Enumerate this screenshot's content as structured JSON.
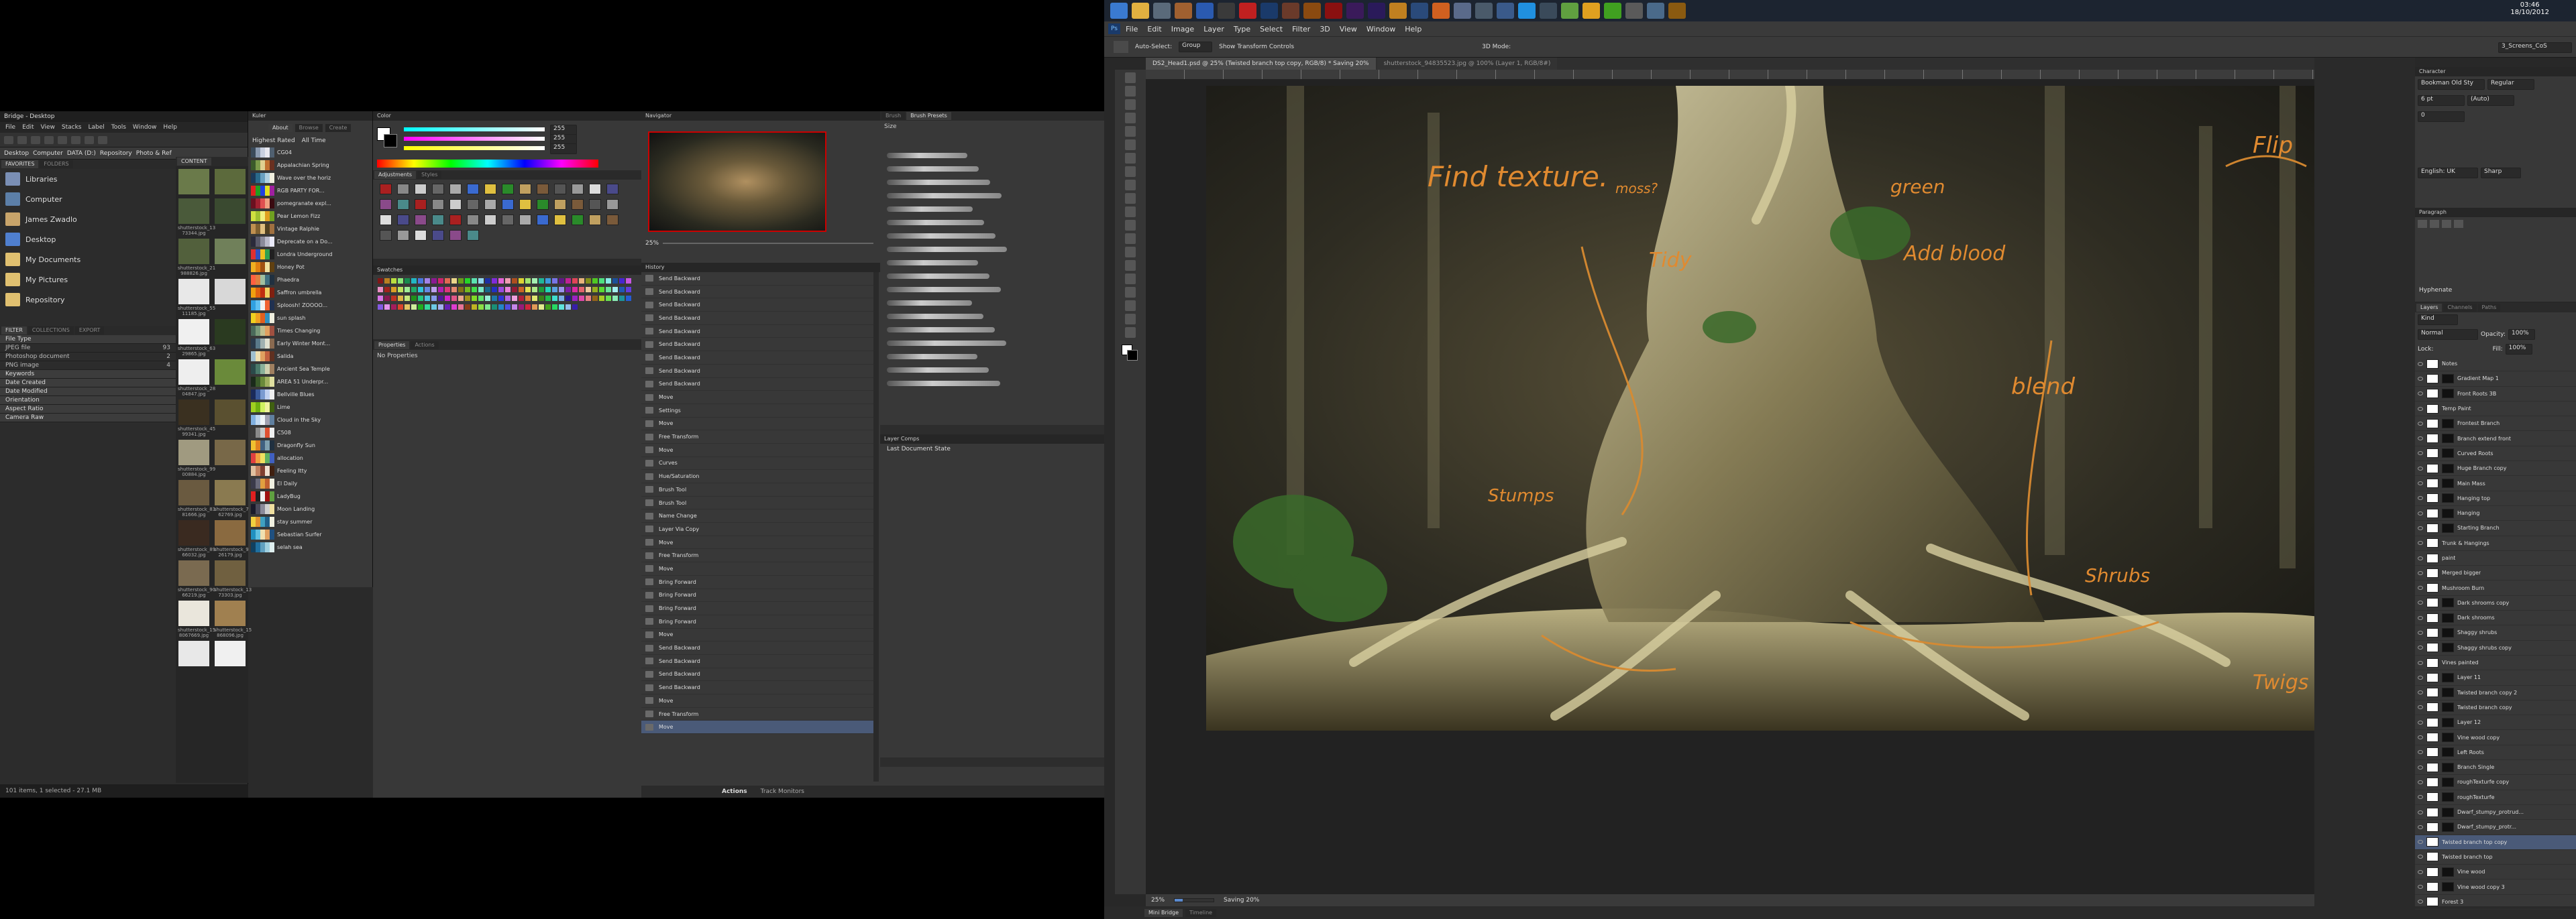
{
  "bridge": {
    "title": "Bridge - Desktop",
    "menu": [
      "File",
      "Edit",
      "View",
      "Stacks",
      "Label",
      "Tools",
      "Window",
      "Help"
    ],
    "breadcrumb": [
      "Desktop",
      "Computer",
      "DATA (D:)",
      "Repository",
      "Photo & Ref"
    ],
    "tabs": [
      "FAVORITES",
      "FOLDERS"
    ],
    "content_tab": "CONTENT",
    "favorites": [
      {
        "label": "Libraries",
        "color": "#7a8fb5"
      },
      {
        "label": "Computer",
        "color": "#5c7fa8"
      },
      {
        "label": "James Zwadlo",
        "color": "#c8a46a"
      },
      {
        "label": "Desktop",
        "color": "#4f7fcf"
      },
      {
        "label": "My Documents",
        "color": "#e0c070"
      },
      {
        "label": "My Pictures",
        "color": "#e0c070"
      },
      {
        "label": "Repository",
        "color": "#e0c070"
      }
    ],
    "filter_tabs": [
      "FILTER",
      "COLLECTIONS",
      "EXPORT"
    ],
    "filters": [
      {
        "label": "File Type",
        "count": "",
        "header": true
      },
      {
        "label": "JPEG file",
        "count": "93",
        "header": false
      },
      {
        "label": "Photoshop document",
        "count": "2",
        "header": false
      },
      {
        "label": "PNG image",
        "count": "4",
        "header": false
      },
      {
        "label": "Keywords",
        "count": "",
        "header": true
      },
      {
        "label": "Date Created",
        "count": "",
        "header": true
      },
      {
        "label": "Date Modified",
        "count": "",
        "header": true
      },
      {
        "label": "Orientation",
        "count": "",
        "header": true
      },
      {
        "label": "Aspect Ratio",
        "count": "",
        "header": true
      },
      {
        "label": "Camera Raw",
        "count": "",
        "header": true
      }
    ],
    "thumbnails": [
      {
        "name": "",
        "color": "#6a7a4a"
      },
      {
        "name": "",
        "color": "#5c6a3c"
      },
      {
        "name": "shutterstock_13 73344.jpg",
        "color": "#4a5a3a"
      },
      {
        "name": "",
        "color": "#3a4a30"
      },
      {
        "name": "shutterstock_21 988826.jpg",
        "color": "#52603c"
      },
      {
        "name": "",
        "color": "#70805a"
      },
      {
        "name": "shutterstock_55 11185.jpg",
        "color": "#e8e8e8"
      },
      {
        "name": "",
        "color": "#d8d8d8"
      },
      {
        "name": "shutterstock_63 29865.jpg",
        "color": "#f0f0f0"
      },
      {
        "name": "",
        "color": "#2a3a20"
      },
      {
        "name": "shutterstock_28 04847.jpg",
        "color": "#eeeeee"
      },
      {
        "name": "",
        "color": "#6a8a3a"
      },
      {
        "name": "shutterstock_45 99341.jpg",
        "color": "#3a3020"
      },
      {
        "name": "",
        "color": "#5a5030"
      },
      {
        "name": "shutterstock_99 00884.jpg",
        "color": "#a09a80"
      },
      {
        "name": "",
        "color": "#786848"
      },
      {
        "name": "shutterstock_83 81666.jpg",
        "color": "#6a5a40"
      },
      {
        "name": "shutterstock_73 62769.jpg",
        "color": "#8a7a50"
      },
      {
        "name": "shutterstock_89 66032.jpg",
        "color": "#3a2a20"
      },
      {
        "name": "shutterstock_96 26179.jpg",
        "color": "#8a6a40"
      },
      {
        "name": "shutterstock_90 66219.jpg",
        "color": "#7a6a50"
      },
      {
        "name": "shutterstock_13 73303.jpg",
        "color": "#706040"
      },
      {
        "name": "shutterstock_15 8067669.jpg",
        "color": "#eae6dc"
      },
      {
        "name": "shutterstock_15 868096.jpg",
        "color": "#a08050"
      },
      {
        "name": "",
        "color": "#e8e8e8"
      },
      {
        "name": "",
        "color": "#f0f0f0"
      }
    ],
    "status": "101 items, 1 selected - 27.1 MB"
  },
  "kuler": {
    "title": "Kuler",
    "tabs": [
      "About",
      "Browse",
      "Create"
    ],
    "sort": [
      "Highest Rated",
      "All Time"
    ],
    "themes": [
      {
        "name": "CG04",
        "colors": [
          "#3a4a5a",
          "#8a9ab0",
          "#c8d0e0",
          "#e8e8f0",
          "#506070"
        ]
      },
      {
        "name": "Appalachian Spring",
        "colors": [
          "#3a5a2a",
          "#7a9a4a",
          "#e0d090",
          "#c07030",
          "#6a3020"
        ]
      },
      {
        "name": "Wave over the horiz",
        "colors": [
          "#1a3a5a",
          "#2a6a8a",
          "#6aa0c0",
          "#b0d0e0",
          "#f0f0e0"
        ]
      },
      {
        "name": "RGB PARTY FOR...",
        "colors": [
          "#e02020",
          "#20a020",
          "#2040e0",
          "#e0e020",
          "#a020a0"
        ]
      },
      {
        "name": "pomegranate expl...",
        "colors": [
          "#6a1020",
          "#a02030",
          "#e05050",
          "#f0a080",
          "#3a0a10"
        ]
      },
      {
        "name": "Pear Lemon Fizz",
        "colors": [
          "#d0e040",
          "#a0c030",
          "#f0f080",
          "#e0a020",
          "#70a020"
        ]
      },
      {
        "name": "Vintage Ralphie",
        "colors": [
          "#c09050",
          "#806030",
          "#e0c080",
          "#504020",
          "#a07040"
        ]
      },
      {
        "name": "Deprecate on a Do...",
        "colors": [
          "#2a2a3a",
          "#5a5a6a",
          "#8a8a9a",
          "#babaca",
          "#eaeafa"
        ]
      },
      {
        "name": "Londra Underground",
        "colors": [
          "#e03030",
          "#3050c0",
          "#f0c020",
          "#30a050",
          "#202020"
        ]
      },
      {
        "name": "Honey Pot",
        "colors": [
          "#f0b020",
          "#e08010",
          "#a05010",
          "#f0e0a0",
          "#604010"
        ]
      },
      {
        "name": "Phaedra",
        "colors": [
          "#ff6040",
          "#e08040",
          "#a0c0a0",
          "#407080",
          "#203040"
        ]
      },
      {
        "name": "Saffron umbrella",
        "colors": [
          "#f0a010",
          "#e06010",
          "#c03010",
          "#f0d060",
          "#802010"
        ]
      },
      {
        "name": "Sploosh! ZOOOO...",
        "colors": [
          "#30a0e0",
          "#60c0f0",
          "#f0f0f0",
          "#f06030",
          "#203050"
        ]
      },
      {
        "name": "sun splash",
        "colors": [
          "#f0d020",
          "#f0a020",
          "#e06020",
          "#3090c0",
          "#f0f0e0"
        ]
      },
      {
        "name": "Times Changing",
        "colors": [
          "#4a6a5a",
          "#7a9a7a",
          "#c0c090",
          "#e0a060",
          "#a05040"
        ]
      },
      {
        "name": "Early Winter Mont...",
        "colors": [
          "#2a3a4a",
          "#5a7a8a",
          "#a0b0b0",
          "#e0e0d0",
          "#8a6a50"
        ]
      },
      {
        "name": "Salida",
        "colors": [
          "#a0c0d0",
          "#f0e0b0",
          "#e0a060",
          "#c06040",
          "#603020"
        ]
      },
      {
        "name": "Ancient Sea Temple",
        "colors": [
          "#2a4a4a",
          "#4a7a6a",
          "#8ab09a",
          "#d0d0b0",
          "#a08060"
        ]
      },
      {
        "name": "AREA 51 Underpr...",
        "colors": [
          "#1a2a1a",
          "#3a5a2a",
          "#6a8a3a",
          "#a0b060",
          "#e0e0a0"
        ]
      },
      {
        "name": "Bellville Blues",
        "colors": [
          "#1a2a5a",
          "#3a5a9a",
          "#7a9ad0",
          "#c0d0f0",
          "#f0f0f0"
        ]
      },
      {
        "name": "Lime",
        "colors": [
          "#a0d020",
          "#70b010",
          "#d0f060",
          "#f0f0a0",
          "#406010"
        ]
      },
      {
        "name": "Cloud in the Sky",
        "colors": [
          "#80b0e0",
          "#c0d8f0",
          "#f0f4f8",
          "#a0a0b0",
          "#6080a0"
        ]
      },
      {
        "name": "C508",
        "colors": [
          "#3a3a3a",
          "#8a8a8a",
          "#c8c8c8",
          "#e05030",
          "#f0f0f0"
        ]
      },
      {
        "name": "Dragonfly Sun",
        "colors": [
          "#f0c030",
          "#e08020",
          "#406080",
          "#80a0b0",
          "#203040"
        ]
      },
      {
        "name": "allocation",
        "colors": [
          "#e04040",
          "#f0a040",
          "#f0e060",
          "#60b060",
          "#4060c0"
        ]
      },
      {
        "name": "Feeling Itty",
        "colors": [
          "#e0c0a0",
          "#c08060",
          "#804030",
          "#f0e0d0",
          "#402010"
        ]
      },
      {
        "name": "El Daily",
        "colors": [
          "#3a3a4a",
          "#6a6a7a",
          "#e0a040",
          "#c06030",
          "#f0f0e0"
        ]
      },
      {
        "name": "LadyBug",
        "colors": [
          "#e02020",
          "#202020",
          "#f0f0f0",
          "#a01010",
          "#60a040"
        ]
      },
      {
        "name": "Moon Landing",
        "colors": [
          "#1a1a2a",
          "#4a4a5a",
          "#8a8a9a",
          "#d0d0d0",
          "#f0e0a0"
        ]
      },
      {
        "name": "stay summer",
        "colors": [
          "#f0d040",
          "#e09030",
          "#40a0c0",
          "#20608a",
          "#f0f0e0"
        ]
      },
      {
        "name": "Sebastian Surfer",
        "colors": [
          "#2090c0",
          "#60c0e0",
          "#f0e0b0",
          "#e0a060",
          "#205080"
        ]
      },
      {
        "name": "selah sea",
        "colors": [
          "#104060",
          "#2070a0",
          "#60a0c0",
          "#a0d0e0",
          "#e0f0f0"
        ]
      }
    ]
  },
  "color_panel": {
    "tabs": [
      "Color"
    ],
    "r": "255",
    "g": "255",
    "b": "255"
  },
  "styles_panel": {
    "tabs": [
      "Adjustments",
      "Styles"
    ]
  },
  "swatches_panel": {
    "tabs": [
      "Swatches"
    ]
  },
  "properties_panel": {
    "tabs": [
      "Properties",
      "Actions"
    ],
    "subtitle": "No Properties"
  },
  "navigator": {
    "title": "Navigator",
    "zoom": "25%"
  },
  "history": {
    "title": "History",
    "items": [
      "Send Backward",
      "Send Backward",
      "Send Backward",
      "Send Backward",
      "Send Backward",
      "Send Backward",
      "Send Backward",
      "Send Backward",
      "Send Backward",
      "Move",
      "Settings",
      "Move",
      "Free Transform",
      "Move",
      "Curves",
      "Hue/Saturation",
      "Brush Tool",
      "Brush Tool",
      "Name Change",
      "Layer Via Copy",
      "Move",
      "Free Transform",
      "Move",
      "Bring Forward",
      "Bring Forward",
      "Bring Forward",
      "Bring Forward",
      "Move",
      "Send Backward",
      "Send Backward",
      "Send Backward",
      "Send Backward",
      "Move",
      "Free Transform",
      "Move"
    ]
  },
  "brush_presets": {
    "tabs": [
      "Brush",
      "Brush Presets"
    ],
    "size_label": "Size"
  },
  "layer_comps": {
    "title": "Layer Comps",
    "item": "Last Document State"
  },
  "actions_bar": {
    "label": "Actions",
    "sub": "Track Monitors"
  },
  "taskbar": {
    "icons": [
      {
        "name": "windows-start-icon",
        "color": "#3a7ad0"
      },
      {
        "name": "explorer-icon",
        "color": "#e0b040"
      },
      {
        "name": "app-icon-1",
        "color": "#5a6a7a"
      },
      {
        "name": "app-icon-2",
        "color": "#a06030"
      },
      {
        "name": "word-icon",
        "color": "#2a5ab0"
      },
      {
        "name": "app-icon-3",
        "color": "#3a3a3a"
      },
      {
        "name": "acrobat-icon",
        "color": "#c02020"
      },
      {
        "name": "photoshop-icon",
        "color": "#1a3a6a"
      },
      {
        "name": "app-icon-4",
        "color": "#6a3a2a"
      },
      {
        "name": "illustrator-icon",
        "color": "#8a4a10"
      },
      {
        "name": "flash-icon",
        "color": "#8a1010"
      },
      {
        "name": "premiere-icon",
        "color": "#3a1a5a"
      },
      {
        "name": "after-effects-icon",
        "color": "#2a1a5a"
      },
      {
        "name": "app-icon-5",
        "color": "#c08020"
      },
      {
        "name": "app-icon-6",
        "color": "#2a4a7a"
      },
      {
        "name": "app-icon-7",
        "color": "#d06020"
      },
      {
        "name": "app-icon-8",
        "color": "#5a6a8a"
      },
      {
        "name": "app-icon-9",
        "color": "#4a5a6a"
      },
      {
        "name": "app-icon-10",
        "color": "#3a5a8a"
      },
      {
        "name": "skype-icon",
        "color": "#2090e0"
      },
      {
        "name": "app-icon-11",
        "color": "#3a4a5a"
      },
      {
        "name": "app-icon-12",
        "color": "#60a040"
      },
      {
        "name": "chrome-icon",
        "color": "#e0a020"
      },
      {
        "name": "spotify-icon",
        "color": "#40a020"
      },
      {
        "name": "app-icon-13",
        "color": "#5a5a5a"
      },
      {
        "name": "app-icon-14",
        "color": "#4a6a8a"
      },
      {
        "name": "bridge-icon",
        "color": "#8a5a10"
      }
    ],
    "clock_time": "03:46",
    "clock_date": "18/10/2012"
  },
  "photoshop": {
    "menu": [
      "File",
      "Edit",
      "Image",
      "Layer",
      "Type",
      "Select",
      "Filter",
      "3D",
      "View",
      "Window",
      "Help"
    ],
    "options": {
      "auto_select": "Auto-Select:",
      "group": "Group",
      "transform": "Show Transform Controls",
      "mode": "3D Mode:",
      "workspace": "3_Screens_CoS"
    },
    "doc_tabs": [
      {
        "label": "DS2_Head1.psd @ 25% (Twisted branch top copy, RGB/8) * Saving 20%",
        "active": true
      },
      {
        "label": "shutterstock_94835523.jpg @ 100% (Layer 1, RGB/8#)",
        "active": false
      }
    ],
    "status_zoom": "25%",
    "status_text": "Saving 20%",
    "bottom_tabs": [
      "Mini Bridge",
      "Timeline"
    ],
    "annotations": [
      "Find texture.",
      "moss?",
      "Tidy",
      "green",
      "Add blood",
      "blend",
      "Flip",
      "Shrubs",
      "Twigs",
      "Stumps"
    ]
  },
  "character_panel": {
    "tabs": [
      "Character"
    ],
    "font": "Bookman Old Sty",
    "style": "Regular",
    "size": "6 pt",
    "leading": "(Auto)",
    "tracking": "0",
    "lang": "English: UK",
    "aa": "Sharp"
  },
  "paragraph_panel": {
    "tabs": [
      "Paragraph"
    ],
    "hyphenate": "Hyphenate"
  },
  "layers_panel": {
    "tabs": [
      "Layers",
      "Channels",
      "Paths"
    ],
    "kind": "Kind",
    "blend": "Normal",
    "opacity_label": "Opacity:",
    "opacity": "100%",
    "lock_label": "Lock:",
    "fill_label": "Fill:",
    "fill": "100%",
    "layers": [
      {
        "name": "Notes",
        "mask": false,
        "sel": false
      },
      {
        "name": "Gradient Map 1",
        "mask": true,
        "sel": false
      },
      {
        "name": "Front Roots 3B",
        "mask": true,
        "sel": false
      },
      {
        "name": "Temp Paint",
        "mask": false,
        "sel": false
      },
      {
        "name": "Frontest Branch",
        "mask": true,
        "sel": false
      },
      {
        "name": "Branch extend front",
        "mask": true,
        "sel": false
      },
      {
        "name": "Curved Roots",
        "mask": true,
        "sel": false
      },
      {
        "name": "Huge Branch copy",
        "mask": true,
        "sel": false
      },
      {
        "name": "Main Mass",
        "mask": true,
        "sel": false
      },
      {
        "name": "Hanging top",
        "mask": true,
        "sel": false
      },
      {
        "name": "Hanging",
        "mask": true,
        "sel": false
      },
      {
        "name": "Starting Branch",
        "mask": true,
        "sel": false
      },
      {
        "name": "Trunk & Hangings",
        "mask": false,
        "sel": false
      },
      {
        "name": "paint",
        "mask": false,
        "sel": false
      },
      {
        "name": "Merged bigger",
        "mask": false,
        "sel": false
      },
      {
        "name": "Mushroom Burn",
        "mask": false,
        "sel": false
      },
      {
        "name": "Dark shrooms copy",
        "mask": true,
        "sel": false
      },
      {
        "name": "Dark shrooms",
        "mask": true,
        "sel": false
      },
      {
        "name": "Shaggy shrubs",
        "mask": true,
        "sel": false
      },
      {
        "name": "Shaggy shrubs copy",
        "mask": true,
        "sel": false
      },
      {
        "name": "Vines painted",
        "mask": false,
        "sel": false
      },
      {
        "name": "Layer 11",
        "mask": true,
        "sel": false
      },
      {
        "name": "Twisted branch copy 2",
        "mask": true,
        "sel": false
      },
      {
        "name": "Twisted branch copy",
        "mask": true,
        "sel": false
      },
      {
        "name": "Layer 12",
        "mask": true,
        "sel": false
      },
      {
        "name": "Vine wood copy",
        "mask": true,
        "sel": false
      },
      {
        "name": "Left Roots",
        "mask": true,
        "sel": false
      },
      {
        "name": "Branch Single",
        "mask": true,
        "sel": false
      },
      {
        "name": "roughTexturfe copy",
        "mask": true,
        "sel": false
      },
      {
        "name": "roughTexturfe",
        "mask": true,
        "sel": false
      },
      {
        "name": "Dwarf_stumpy_protrud...",
        "mask": true,
        "sel": false
      },
      {
        "name": "Dwarf_stumpy_protr...",
        "mask": true,
        "sel": false
      },
      {
        "name": "Twisted branch top copy",
        "mask": false,
        "sel": true
      },
      {
        "name": "Twisted branch top",
        "mask": false,
        "sel": false
      },
      {
        "name": "Vine wood",
        "mask": true,
        "sel": false
      },
      {
        "name": "Vine wood copy 3",
        "mask": true,
        "sel": false
      },
      {
        "name": "Forest 3",
        "mask": false,
        "sel": false
      }
    ]
  }
}
